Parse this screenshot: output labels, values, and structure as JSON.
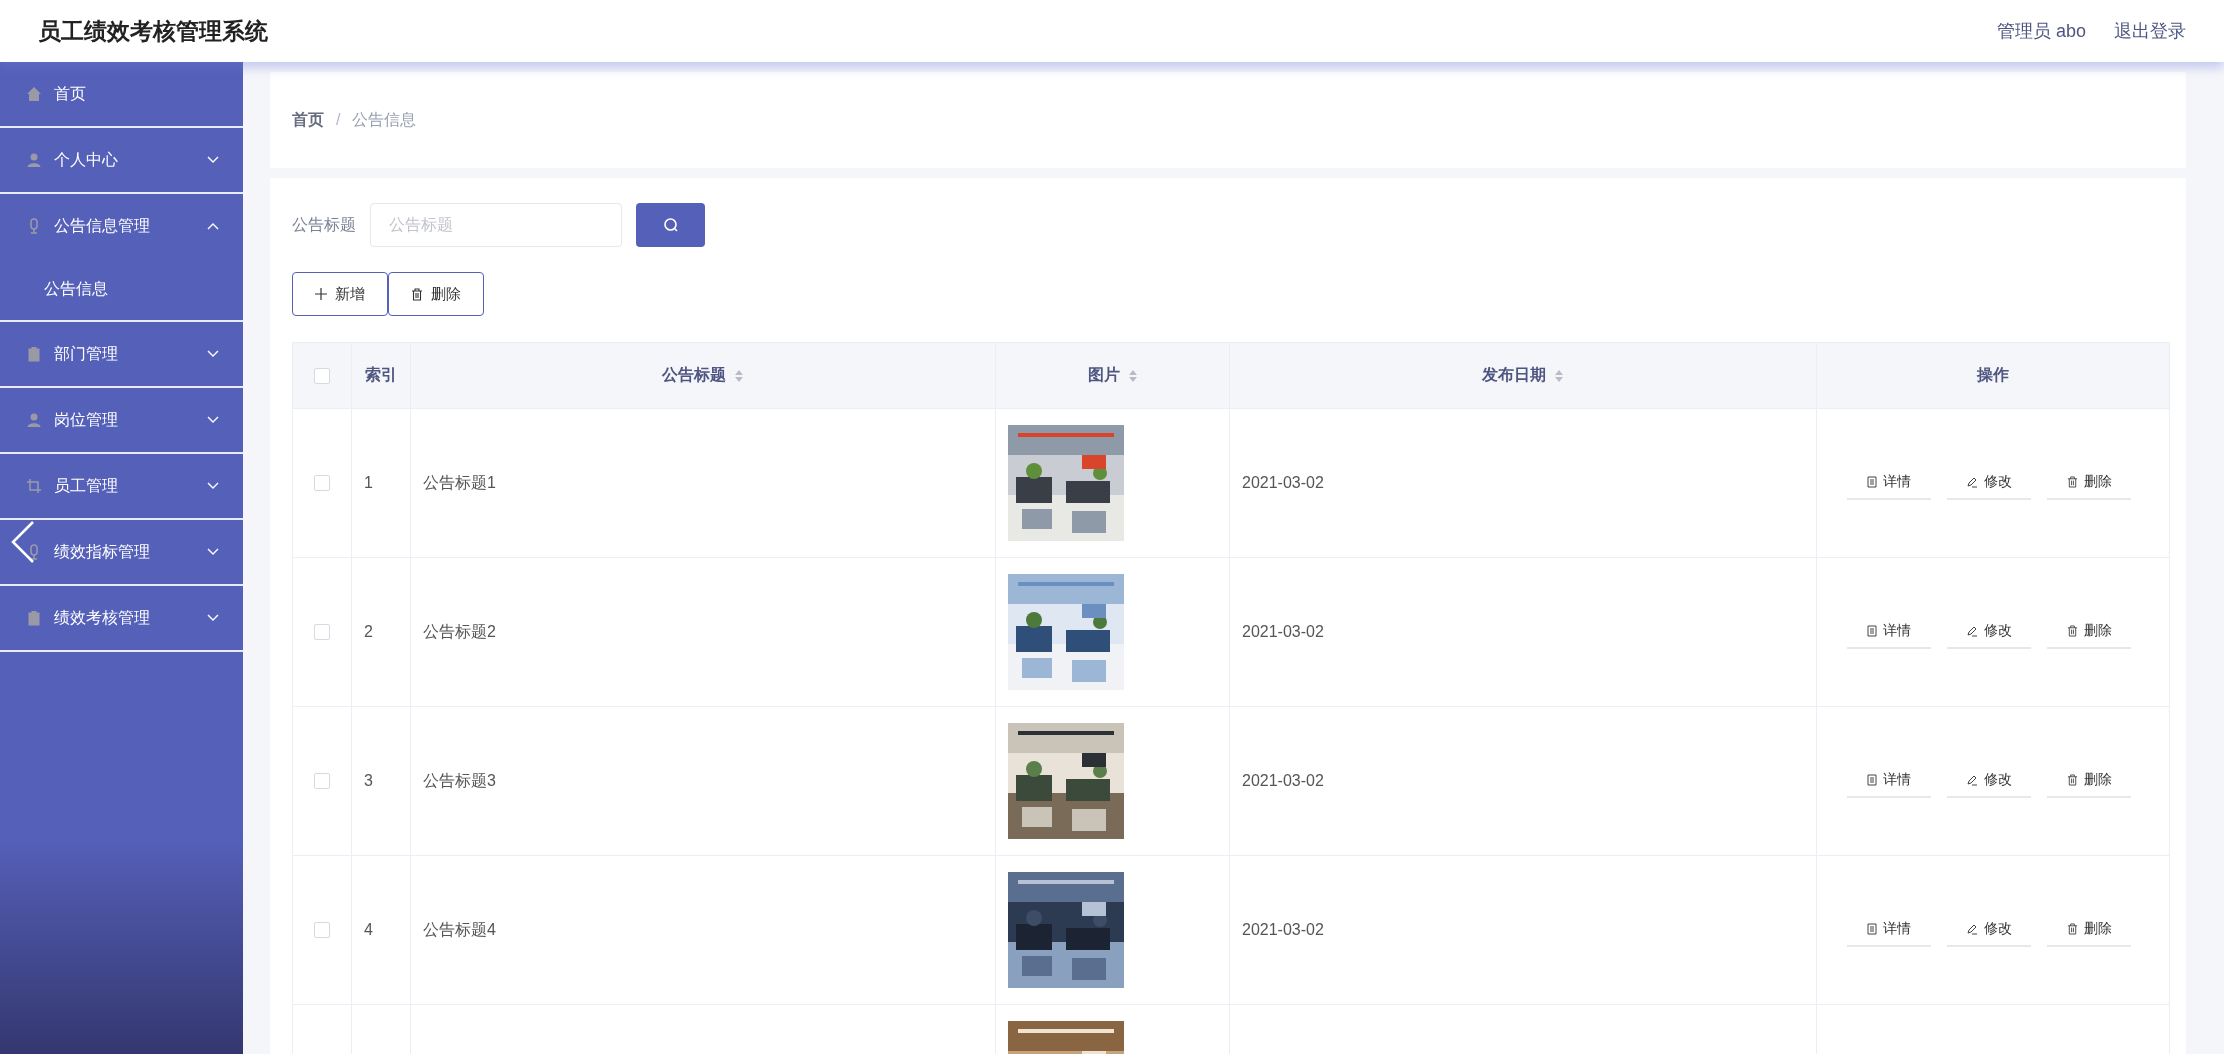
{
  "header": {
    "title": "员工绩效考核管理系统",
    "user": "管理员 abo",
    "logout": "退出登录"
  },
  "sidebar": {
    "items": [
      {
        "kind": "link",
        "label": "首页"
      },
      {
        "kind": "menu",
        "label": "个人中心",
        "expanded": false
      },
      {
        "kind": "menu",
        "label": "公告信息管理",
        "expanded": true,
        "children": [
          {
            "label": "公告信息"
          }
        ]
      },
      {
        "kind": "menu",
        "label": "部门管理",
        "expanded": false
      },
      {
        "kind": "menu",
        "label": "岗位管理",
        "expanded": false
      },
      {
        "kind": "menu",
        "label": "员工管理",
        "expanded": false
      },
      {
        "kind": "menu",
        "label": "绩效指标管理",
        "expanded": false
      },
      {
        "kind": "menu",
        "label": "绩效考核管理",
        "expanded": false
      }
    ]
  },
  "breadcrumb": {
    "separator": "/",
    "items": [
      "首页",
      "公告信息"
    ]
  },
  "search": {
    "label": "公告标题",
    "placeholder": "公告标题"
  },
  "toolbar": {
    "add": "新增",
    "delete": "删除"
  },
  "table": {
    "select_all_checked": false,
    "columns": [
      {
        "label": "索引",
        "sortable": false
      },
      {
        "label": "公告标题",
        "sortable": true
      },
      {
        "label": "图片",
        "sortable": true
      },
      {
        "label": "发布日期",
        "sortable": true
      },
      {
        "label": "操作",
        "sortable": false
      }
    ],
    "rows": [
      {
        "checked": false,
        "index": "1",
        "title": "公告标题1",
        "picture": {
          "kind": "picture"
        },
        "date": "2021-03-02",
        "actions": [
          "详情",
          "修改",
          "删除"
        ]
      },
      {
        "checked": false,
        "index": "2",
        "title": "公告标题2",
        "picture": {
          "kind": "picture"
        },
        "date": "2021-03-02",
        "actions": [
          "详情",
          "修改",
          "删除"
        ]
      },
      {
        "checked": false,
        "index": "3",
        "title": "公告标题3",
        "picture": {
          "kind": "picture"
        },
        "date": "2021-03-02",
        "actions": [
          "详情",
          "修改",
          "删除"
        ]
      },
      {
        "checked": false,
        "index": "4",
        "title": "公告标题4",
        "picture": {
          "kind": "picture"
        },
        "date": "2021-03-02",
        "actions": [
          "详情",
          "修改",
          "删除"
        ]
      },
      {
        "picture": {
          "kind": "picture"
        }
      }
    ]
  }
}
